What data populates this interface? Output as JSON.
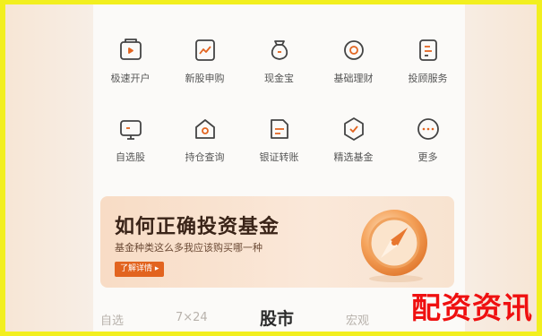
{
  "shortcuts": [
    {
      "label": "极速开户",
      "icon": "account-open-icon"
    },
    {
      "label": "新股申购",
      "icon": "ipo-subscribe-icon"
    },
    {
      "label": "现金宝",
      "icon": "cash-bag-icon"
    },
    {
      "label": "基础理财",
      "icon": "basic-finance-icon"
    },
    {
      "label": "投顾服务",
      "icon": "advisor-service-icon"
    },
    {
      "label": "自选股",
      "icon": "watchlist-icon"
    },
    {
      "label": "持仓查询",
      "icon": "position-query-icon"
    },
    {
      "label": "银证转账",
      "icon": "bank-transfer-icon"
    },
    {
      "label": "精选基金",
      "icon": "selected-fund-icon"
    },
    {
      "label": "更多",
      "icon": "more-icon"
    }
  ],
  "banner": {
    "title": "如何正确投资基金",
    "subtitle": "基金种类这么多我应该购买哪一种",
    "button": "了解详情 ▸"
  },
  "tabs": [
    {
      "label": "自选",
      "active": false
    },
    {
      "label": "7×24",
      "active": false
    },
    {
      "label": "股市",
      "active": true
    },
    {
      "label": "宏观",
      "active": false
    }
  ],
  "watermark": "配资资讯",
  "colors": {
    "accent": "#e2641f",
    "frame": "#f2ef1f",
    "watermark": "#ef1010"
  }
}
